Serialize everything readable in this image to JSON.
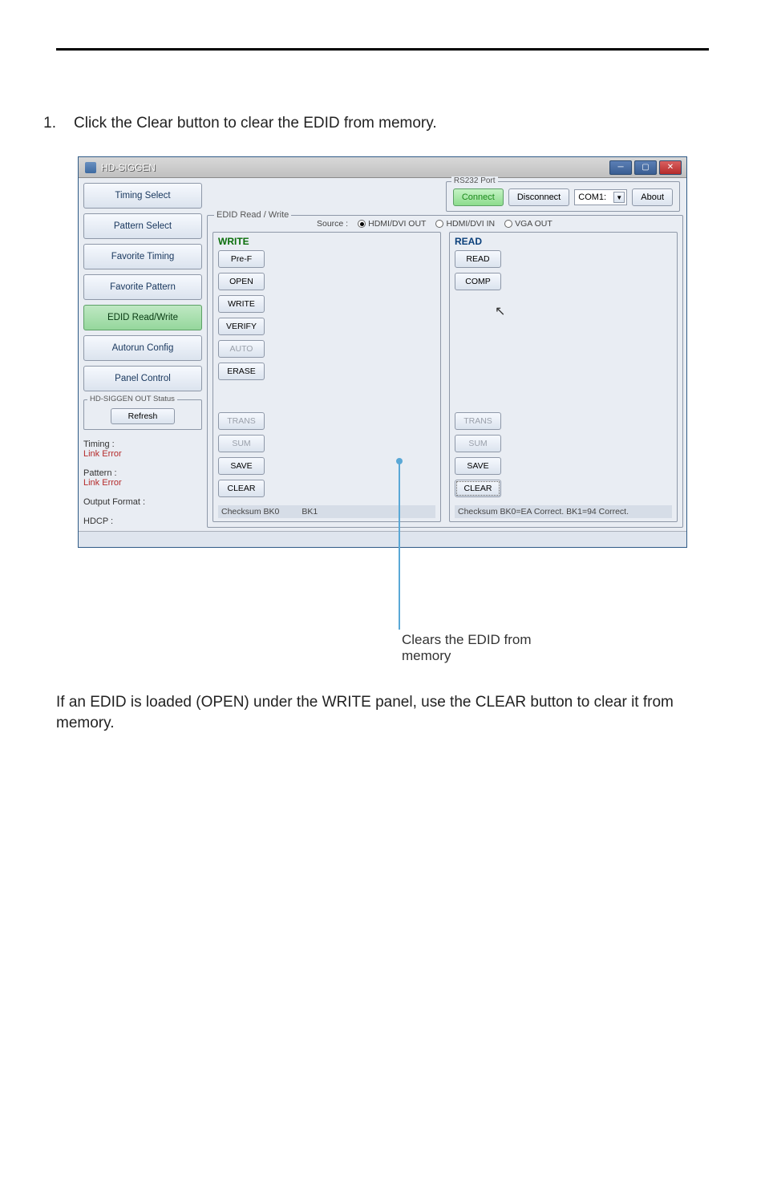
{
  "step": {
    "num": "1.",
    "text": "Click the Clear button to clear the EDID from memory."
  },
  "window": {
    "title": "HD-SIGGEN",
    "rs232": {
      "group_label": "RS232 Port",
      "connect": "Connect",
      "disconnect": "Disconnect",
      "port": "COM1:",
      "about": "About"
    },
    "sidebar": {
      "items": [
        "Timing Select",
        "Pattern Select",
        "Favorite Timing",
        "Favorite Pattern",
        "EDID Read/Write",
        "Autorun Config",
        "Panel Control"
      ],
      "status_group": "HD-SIGGEN OUT Status",
      "refresh": "Refresh",
      "timing_label": "Timing :",
      "timing_err": "Link Error",
      "pattern_label": "Pattern :",
      "pattern_err": "Link Error",
      "outfmt_label": "Output Format :",
      "hdcp_label": "HDCP :"
    },
    "edid": {
      "group_label": "EDID Read / Write",
      "source_label": "Source :",
      "src1": "HDMI/DVI OUT",
      "src2": "HDMI/DVI  IN",
      "src3": "VGA OUT",
      "write_header": "WRITE",
      "read_header": "READ",
      "write_buttons": [
        "Pre-F",
        "OPEN",
        "WRITE",
        "VERIFY",
        "AUTO",
        "ERASE"
      ],
      "write_bottom": [
        "TRANS",
        "SUM",
        "SAVE",
        "CLEAR"
      ],
      "read_buttons": [
        "READ",
        "COMP"
      ],
      "read_bottom": [
        "TRANS",
        "SUM",
        "SAVE",
        "CLEAR"
      ],
      "chk_write_a": "Checksum BK0",
      "chk_write_b": "BK1",
      "chk_read": "Checksum BK0=EA Correct.    BK1=94 Correct."
    }
  },
  "callout": "Clears the EDID from memory",
  "body_text": "If an EDID is loaded (OPEN) under the WRITE panel, use the CLEAR button to clear it from memory."
}
